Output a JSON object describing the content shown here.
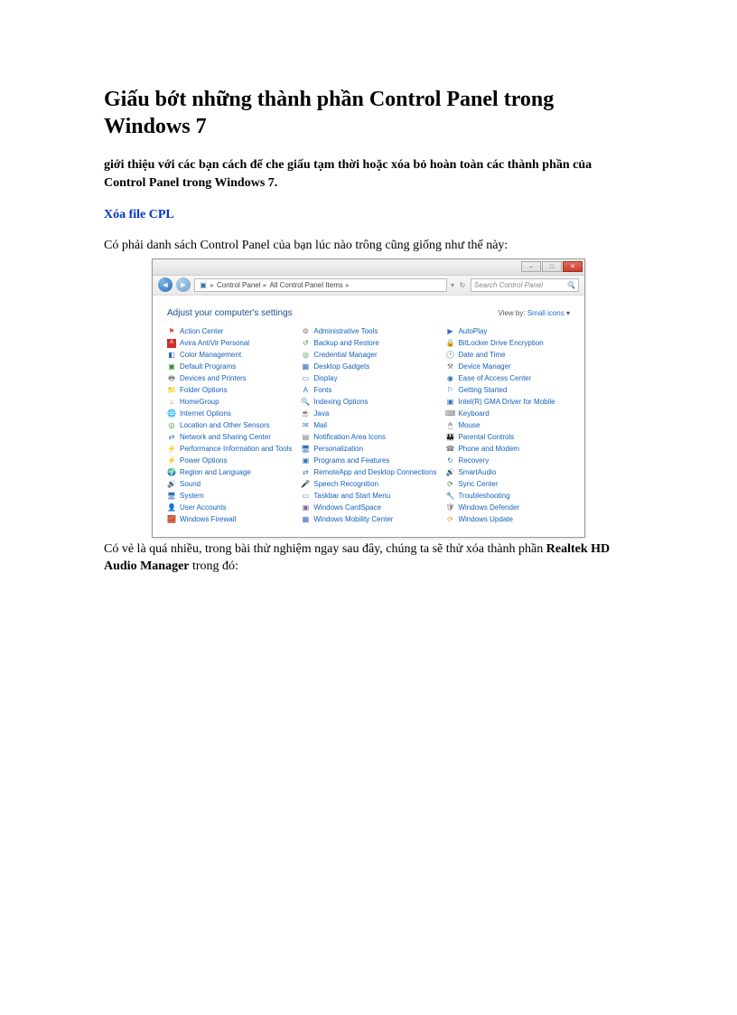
{
  "article": {
    "title": "Giấu bớt những thành phần Control Panel trong Windows 7",
    "intro": "giới thiệu với các bạn cách để che giấu tạm thời hoặc xóa bỏ hoàn toàn các thành phần của Control Panel trong Windows 7.",
    "section_link": "Xóa file CPL",
    "para1": "Có phải danh sách Control Panel của bạn lúc nào trông cũng giống như thế này:",
    "para2_a": "Có vẻ là quá nhiều, trong bài thử nghiệm ngay sau đây, chúng ta sẽ thử xóa thành phần ",
    "para2_bold": "Realtek HD Audio Manager",
    "para2_b": " trong đó:"
  },
  "cp": {
    "breadcrumb": {
      "root": "Control Panel",
      "current": "All Control Panel Items"
    },
    "search_placeholder": "Search Control Panel",
    "header_title": "Adjust your computer's settings",
    "viewby_label": "View by:",
    "viewby_value": "Small icons",
    "col1": [
      "Action Center",
      "Avira AntiVir Personal",
      "Color Management",
      "Default Programs",
      "Devices and Printers",
      "Folder Options",
      "HomeGroup",
      "Internet Options",
      "Location and Other Sensors",
      "Network and Sharing Center",
      "Performance Information and Tools",
      "Power Options",
      "Region and Language",
      "Sound",
      "System",
      "User Accounts",
      "Windows Firewall"
    ],
    "col2": [
      "Administrative Tools",
      "Backup and Restore",
      "Credential Manager",
      "Desktop Gadgets",
      "Display",
      "Fonts",
      "Indexing Options",
      "Java",
      "Mail",
      "Notification Area Icons",
      "Personalization",
      "Programs and Features",
      "RemoteApp and Desktop Connections",
      "Speech Recognition",
      "Taskbar and Start Menu",
      "Windows CardSpace",
      "Windows Mobility Center"
    ],
    "col3": [
      "AutoPlay",
      "BitLocker Drive Encryption",
      "Date and Time",
      "Device Manager",
      "Ease of Access Center",
      "Getting Started",
      "Intel(R) GMA Driver for Mobile",
      "Keyboard",
      "Mouse",
      "Parental Controls",
      "Phone and Modem",
      "Recovery",
      "SmartAudio",
      "Sync Center",
      "Troubleshooting",
      "Windows Defender",
      "Windows Update"
    ]
  }
}
